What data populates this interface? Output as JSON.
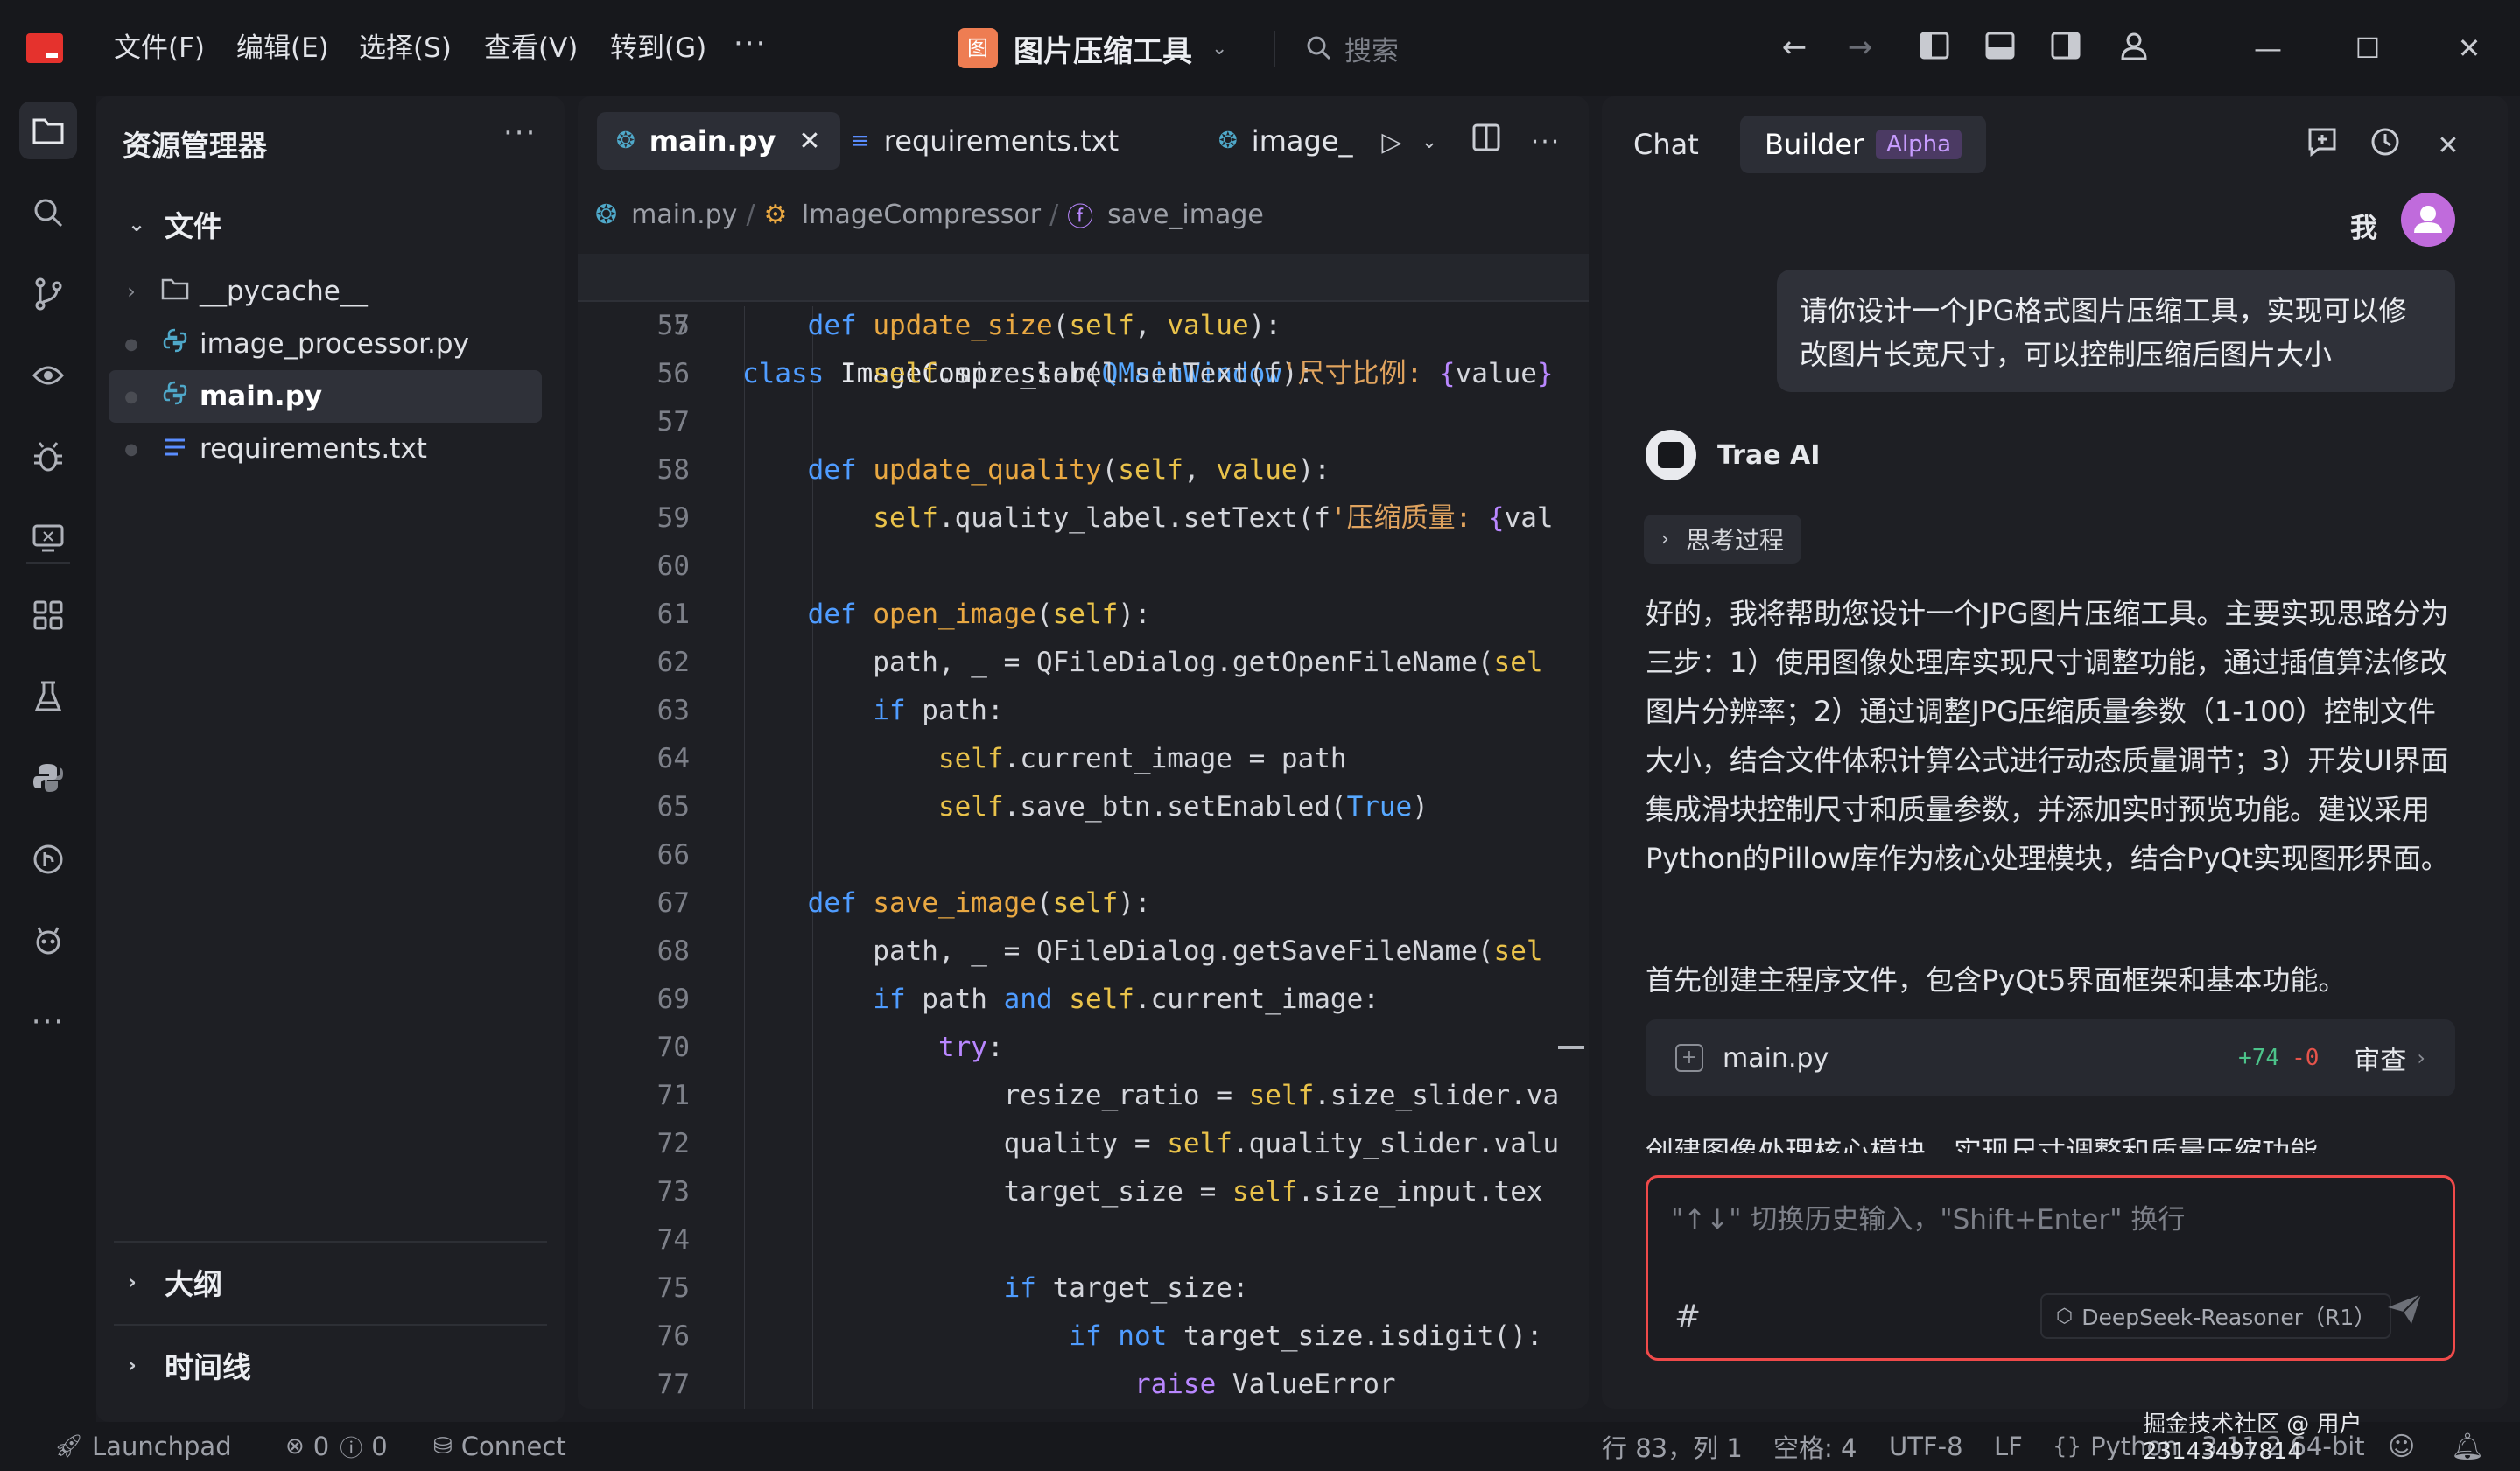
{
  "titlebar": {
    "menus": [
      "文件(F)",
      "编辑(E)",
      "选择(S)",
      "查看(V)",
      "转到(G)"
    ],
    "more": "···",
    "project_name": "图片压缩工具",
    "project_icon_glyph": "图",
    "search_placeholder": "搜索"
  },
  "explorer": {
    "title": "资源管理器",
    "more": "···",
    "folder_section": "文件",
    "items": [
      {
        "label": "__pycache__",
        "type": "folder",
        "icon": "folder-icon"
      },
      {
        "label": "image_processor.py",
        "type": "python",
        "icon": "python-file-icon"
      },
      {
        "label": "main.py",
        "type": "python",
        "icon": "python-file-icon",
        "selected": true
      },
      {
        "label": "requirements.txt",
        "type": "text",
        "icon": "text-file-icon"
      }
    ],
    "outline_label": "大纲",
    "timeline_label": "时间线"
  },
  "editor": {
    "tabs": [
      {
        "label": "main.py",
        "active": true
      },
      {
        "label": "requirements.txt"
      },
      {
        "label": "image_"
      }
    ],
    "breadcrumb": [
      "main.py",
      "ImageCompressor",
      "save_image"
    ],
    "sticky_line": {
      "number": "7",
      "text": "class ImageCompressor(QMainWindow):"
    },
    "lines": [
      {
        "n": "55",
        "indent": 1
      },
      {
        "n": "56",
        "indent": 2
      },
      {
        "n": "57",
        "indent": 0
      },
      {
        "n": "58",
        "indent": 1
      },
      {
        "n": "59",
        "indent": 2
      },
      {
        "n": "60",
        "indent": 0
      },
      {
        "n": "61",
        "indent": 1
      },
      {
        "n": "62",
        "indent": 2
      },
      {
        "n": "63",
        "indent": 2
      },
      {
        "n": "64",
        "indent": 3
      },
      {
        "n": "65",
        "indent": 3
      },
      {
        "n": "66",
        "indent": 0
      },
      {
        "n": "67",
        "indent": 1
      },
      {
        "n": "68",
        "indent": 2
      },
      {
        "n": "69",
        "indent": 2
      },
      {
        "n": "70",
        "indent": 3
      },
      {
        "n": "71",
        "indent": 4
      },
      {
        "n": "72",
        "indent": 4
      },
      {
        "n": "73",
        "indent": 4
      },
      {
        "n": "74",
        "indent": 0
      },
      {
        "n": "75",
        "indent": 4
      },
      {
        "n": "76",
        "indent": 5
      },
      {
        "n": "77",
        "indent": 6
      }
    ]
  },
  "chat": {
    "tabs": {
      "chat": "Chat",
      "builder": "Builder",
      "badge": "Alpha"
    },
    "user_name": "我",
    "user_message": "请你设计一个JPG格式图片压缩工具，实现可以修改图片长宽尺寸，可以控制压缩后图片大小",
    "ai_name": "Trae AI",
    "thinking_label": "思考过程",
    "response": "好的，我将帮助您设计一个JPG图片压缩工具。主要实现思路分为三步：1）使用图像处理库实现尺寸调整功能，通过插值算法修改图片分辨率；2）通过调整JPG压缩质量参数（1-100）控制文件大小，结合文件体积计算公式进行动态质量调节；3）开发UI界面集成滑块控制尺寸和质量参数，并添加实时预览功能。建议采用Python的Pillow库作为核心处理模块，结合PyQt实现图形界面。",
    "response2": "首先创建主程序文件，包含PyQt5界面框架和基本功能。",
    "file_card": {
      "name": "main.py",
      "added": "+74",
      "removed": "-0",
      "review": "审查"
    },
    "partial_text": "创建图像处理核心模块，实现尺寸调整和质量压缩功能",
    "input_placeholder": "\"↑↓\" 切换历史输入，\"Shift+Enter\" 换行",
    "hash": "#",
    "model": "DeepSeek-Reasoner（R1）"
  },
  "statusbar": {
    "launchpad": "Launchpad",
    "errors": "0",
    "warnings": "0",
    "connect": "Connect",
    "position": "行 83，列 1",
    "spaces": "空格: 4",
    "encoding": "UTF-8",
    "eol": "LF",
    "language": "Python",
    "version": "3.11.2 64-bit"
  },
  "watermark": "掘金技术社区 @ 用户23143497814",
  "colors": {
    "accent_red": "#e5322d",
    "project_icon": "#ee7d52",
    "keyword": "#4f9cff",
    "function": "#e9a842",
    "string": "#e0a35e",
    "added": "#4cc38a",
    "removed": "#e5534b",
    "input_border": "#f04a4a"
  }
}
